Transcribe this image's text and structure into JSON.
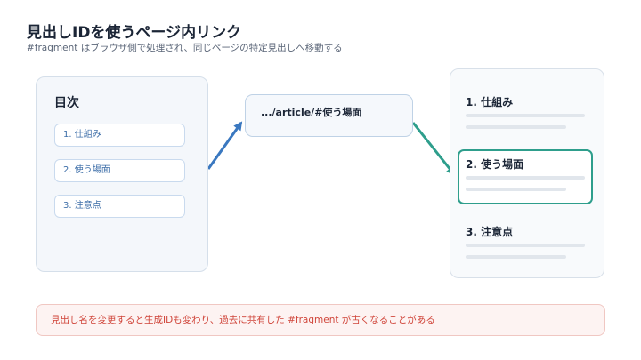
{
  "header": {
    "title": "見出しIDを使うページ内リンク",
    "subtitle": "#fragment はブラウザ側で処理され、同じページの特定見出しへ移動する"
  },
  "toc": {
    "heading": "目次",
    "items": [
      {
        "label": "1. 仕組み"
      },
      {
        "label": "2. 使う場面"
      },
      {
        "label": "3. 注意点"
      }
    ]
  },
  "url": {
    "text": ".../article/#使う場面"
  },
  "page": {
    "sections": [
      {
        "title": "1. 仕組み",
        "active": false
      },
      {
        "title": "2. 使う場面",
        "active": true
      },
      {
        "title": "3. 注意点",
        "active": false
      }
    ]
  },
  "note": {
    "text": "見出し名を変更すると生成IDも変わり、過去に共有した #fragment が古くなることがある"
  },
  "colors": {
    "arrow_blue": "#3a78c0",
    "arrow_teal": "#2e9e8c",
    "warning": "#d0453a"
  }
}
